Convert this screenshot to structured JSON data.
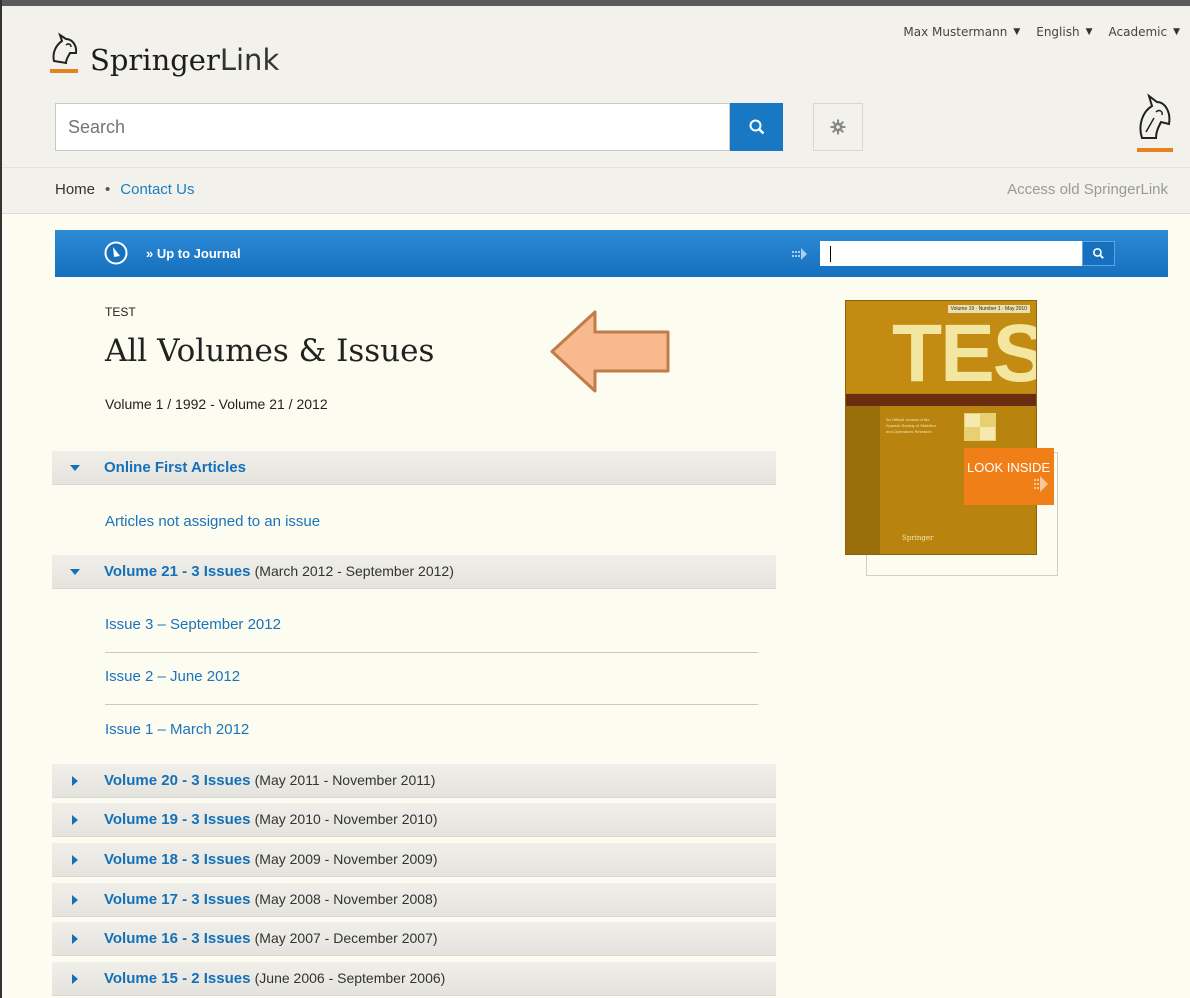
{
  "header": {
    "logo": {
      "brand": "Springer",
      "suffix": "Link"
    },
    "user_menu": [
      {
        "label": "Max Mustermann"
      },
      {
        "label": "English"
      },
      {
        "label": "Academic"
      }
    ],
    "search": {
      "placeholder": "Search"
    }
  },
  "nav": {
    "home": "Home",
    "separator": "•",
    "contact": "Contact Us",
    "old_site": "Access old SpringerLink"
  },
  "journal_bar": {
    "up_link": "» Up to Journal",
    "search_value": ""
  },
  "page": {
    "journal_label": "TEST",
    "title": "All Volumes & Issues",
    "volume_range": "Volume 1 / 1992 - Volume 21 / 2012"
  },
  "accordion": {
    "online_first": {
      "title": "Online First Articles",
      "link": "Articles not assigned to an issue"
    },
    "volume_21": {
      "title": "Volume 21 - 3 Issues",
      "range": "(March 2012 - September 2012)",
      "issues": [
        "Issue 3 – September 2012",
        "Issue 2 – June 2012",
        "Issue 1 – March 2012"
      ]
    },
    "collapsed_volumes": [
      {
        "title": "Volume 20 - 3 Issues",
        "range": "(May 2011 - November 2011)"
      },
      {
        "title": "Volume 19 - 3 Issues",
        "range": "(May 2010 - November 2010)"
      },
      {
        "title": "Volume 18 - 3 Issues",
        "range": "(May 2009 - November 2009)"
      },
      {
        "title": "Volume 17 - 3 Issues",
        "range": "(May 2008 - November 2008)"
      },
      {
        "title": "Volume 16 - 3 Issues",
        "range": "(May 2007 - December 2007)"
      },
      {
        "title": "Volume 15 - 2 Issues",
        "range": "(June 2006 - September 2006)"
      }
    ]
  },
  "cover": {
    "title": "TEST",
    "volume_line": "Volume 19 · Number 1 · May 2010",
    "subtitle": "An Official Journal of the Spanish Society of Statistics and Operations Research",
    "logo_letters": "SEIO",
    "publisher": "Springer",
    "look_inside": "LOOK INSIDE"
  },
  "colors": {
    "link_blue": "#1b73bb",
    "bar_blue": "#1878c4",
    "orange": "#f07f17",
    "page_bg": "#fdfcf0"
  }
}
